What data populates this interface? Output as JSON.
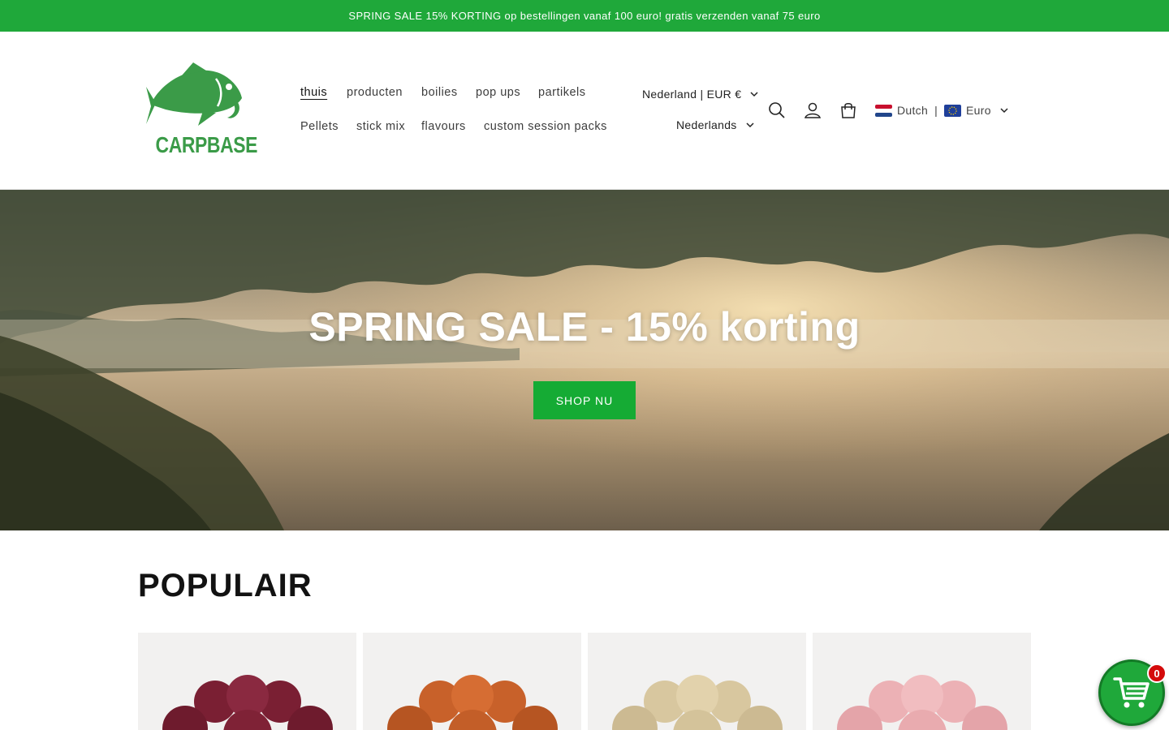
{
  "announcement": {
    "text": "SPRING SALE 15% KORTING op bestellingen vanaf 100 euro! gratis verzenden vanaf 75 euro"
  },
  "logo": {
    "text": "CARPBASE"
  },
  "nav": {
    "row1": [
      "thuis",
      "producten",
      "boilies",
      "pop ups",
      "partikels"
    ],
    "row2": [
      "Pellets",
      "stick mix",
      "flavours",
      "custom session packs"
    ]
  },
  "selectors": {
    "country": "Nederland | EUR €",
    "language": "Nederlands"
  },
  "locale": {
    "language": "Dutch",
    "separator": "|",
    "currency": "Euro"
  },
  "hero": {
    "title": "SPRING SALE - 15% korting",
    "button": "SHOP NU"
  },
  "section": {
    "title": "POPULAIR"
  },
  "floating_cart": {
    "count": "0"
  },
  "colors": {
    "brand_green": "#1fa83a",
    "button_green": "#15ab34",
    "logo_green": "#3b9b48",
    "badge_red": "#d40b0b"
  },
  "icons": [
    "search-icon",
    "account-icon",
    "cart-icon",
    "chevron-down-icon",
    "nl-flag-icon",
    "eu-flag-icon",
    "floating-cart-icon"
  ]
}
